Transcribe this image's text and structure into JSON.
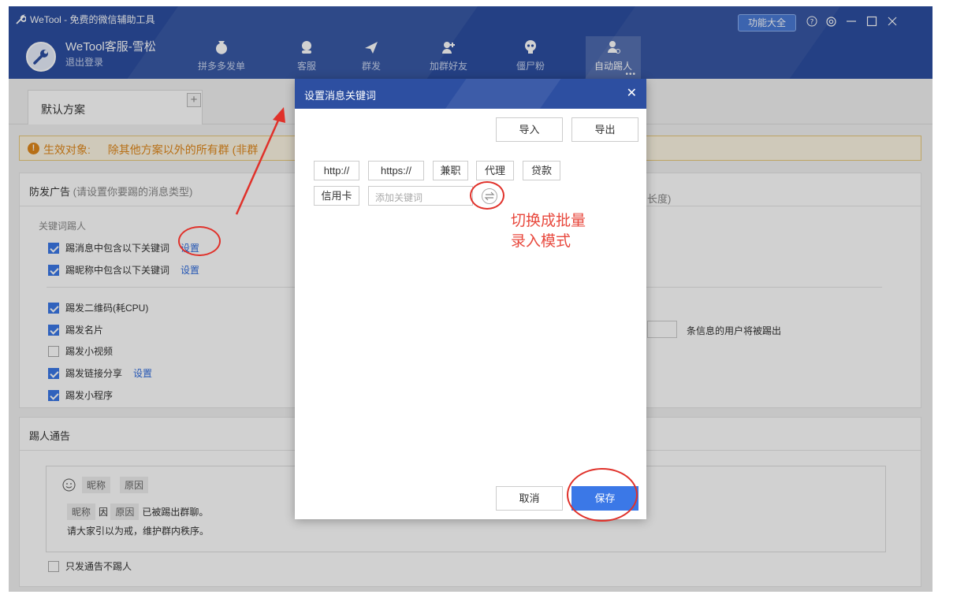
{
  "app": {
    "title": "WeTool - 免费的微信辅助工具",
    "account_name": "WeTool客服-雪松",
    "logout": "退出登录",
    "features_button": "功能大全"
  },
  "nav": {
    "tabs": [
      {
        "label": "拼多多发单",
        "icon": "money-bag-icon"
      },
      {
        "label": "客服",
        "icon": "customer-service-icon"
      },
      {
        "label": "群发",
        "icon": "send-plane-icon"
      },
      {
        "label": "加群好友",
        "icon": "add-friend-icon"
      },
      {
        "label": "僵尸粉",
        "icon": "skull-icon"
      },
      {
        "label": "自动踢人",
        "icon": "auto-kick-icon"
      }
    ],
    "active_index": 5
  },
  "scheme": {
    "tab_label": "默认方案",
    "add_symbol": "+"
  },
  "notice": {
    "label": "生效对象:",
    "text": "除其他方案以外的所有群 (非群"
  },
  "anti_ad": {
    "title": "防发广告",
    "hint": "(请设置你要踢的消息类型)",
    "right_hint": "长度)",
    "keyword_section": "关键词踢人",
    "set_link": "设置",
    "items": [
      {
        "label": "踢消息中包含以下关键词",
        "checked": true,
        "has_link": true
      },
      {
        "label": "踢昵称中包含以下关键词",
        "checked": true,
        "has_link": true
      },
      {
        "label": "踢发二维码(耗CPU)",
        "checked": true,
        "has_link": false
      },
      {
        "label": "踢发名片",
        "checked": true,
        "has_link": false
      },
      {
        "label": "踢发小视频",
        "checked": false,
        "has_link": false
      },
      {
        "label": "踢发链接分享",
        "checked": true,
        "has_link": true
      },
      {
        "label": "踢发小程序",
        "checked": true,
        "has_link": false
      }
    ],
    "count_suffix": "条信息的用户将被踢出"
  },
  "announce": {
    "title": "踢人通告",
    "chips": [
      "昵称",
      "原因"
    ],
    "line1_chip1": "昵称",
    "line1_mid": "因",
    "line1_chip2": "原因",
    "line1_end": "已被踢出群聊。",
    "line2": "请大家引以为戒，维护群内秩序。",
    "only_notice": "只发通告不踢人",
    "only_notice_checked": false
  },
  "modal": {
    "title": "设置消息关键词",
    "import": "导入",
    "export": "导出",
    "keywords": [
      "http://",
      "https://",
      "兼职",
      "代理",
      "贷款",
      "信用卡"
    ],
    "input_placeholder": "添加关键词",
    "cancel": "取消",
    "save": "保存"
  },
  "annotation": {
    "line1": "切换成批量",
    "line2": "录入模式",
    "color": "#e8483d"
  }
}
